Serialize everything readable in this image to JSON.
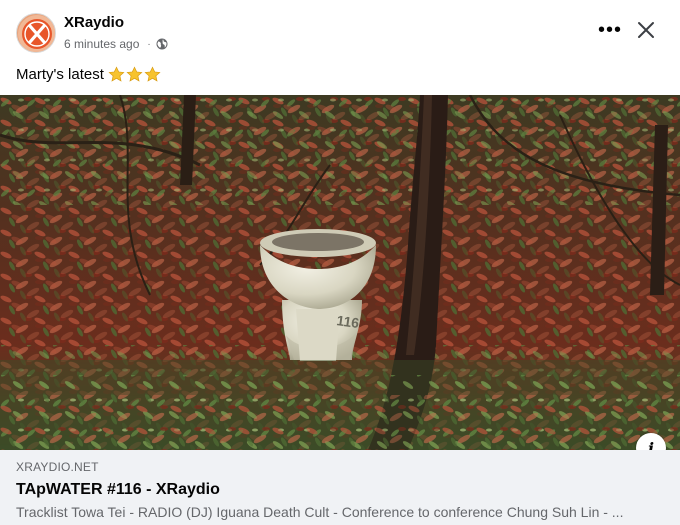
{
  "post": {
    "page_name": "XRaydio",
    "timestamp": "6 minutes ago",
    "separator": "·",
    "audience_icon": "globe-icon",
    "more_label": "•••",
    "caption": "Marty's latest",
    "caption_emoji_count": 3,
    "caption_emoji_icon": "star-icon"
  },
  "photo": {
    "overlay_number": "116",
    "info_label": "i"
  },
  "link": {
    "domain": "XRAYDIO.NET",
    "title": "TApWATER #116 - XRaydio",
    "description": "Tracklist Towa Tei - RADIO (DJ) Iguana Death Cult - Conference to conference Chung Suh Lin - ..."
  },
  "colors": {
    "brand_orange": "#e8562a",
    "secondary_text": "#65676b",
    "link_bg": "#f0f2f5",
    "star": "#f7c32e"
  }
}
